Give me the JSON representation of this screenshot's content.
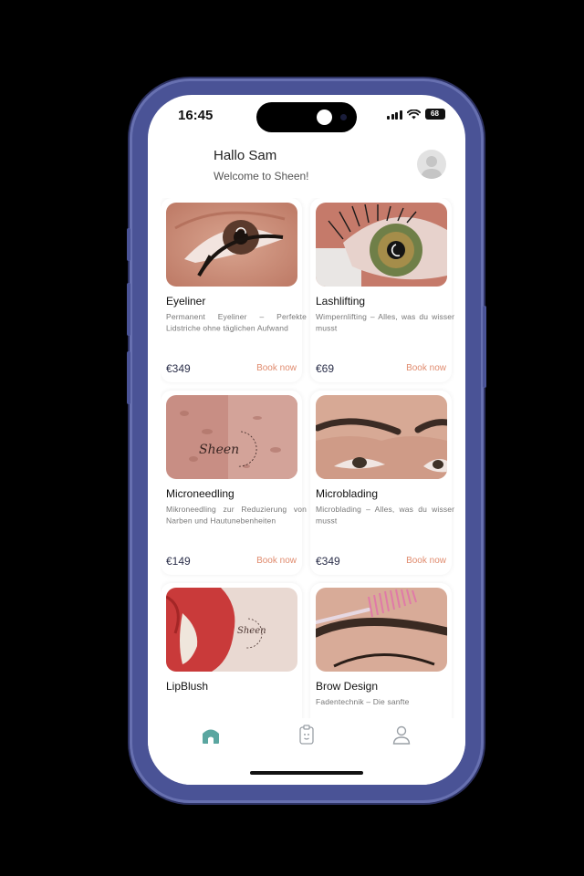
{
  "status_bar": {
    "time": "16:45",
    "battery": "68"
  },
  "header": {
    "title": "Hallo Sam",
    "subtitle": "Welcome to Sheen!"
  },
  "services": [
    {
      "title": "Eyeliner",
      "description": "Permanent Eyeliner – Perfekte Lidstriche ohne täglichen Aufwand",
      "price": "€349",
      "action": "Book now",
      "image_icon": "eyeliner-photo"
    },
    {
      "title": "Lashlifting",
      "description": "Wimpernlifting – Alles, was du wissen musst",
      "price": "€69",
      "action": "Book now",
      "image_icon": "lashlifting-photo"
    },
    {
      "title": "Microneedling",
      "description": "Mikroneedling zur Reduzierung von Narben und Hautunebenheiten",
      "price": "€149",
      "action": "Book now",
      "image_icon": "microneedling-photo"
    },
    {
      "title": "Microblading",
      "description": "Microblading – Alles, was du wissen musst",
      "price": "€349",
      "action": "Book now",
      "image_icon": "microblading-photo"
    },
    {
      "title": "LipBlush",
      "description": "",
      "price": "",
      "action": "",
      "image_icon": "lipblush-photo"
    },
    {
      "title": "Brow Design",
      "description": "Fadentechnik – Die sanfte",
      "price": "",
      "action": "",
      "image_icon": "brow-design-photo"
    }
  ],
  "watermark_text": "Sheen",
  "tab_bar": {
    "items": [
      {
        "icon": "home-icon",
        "active": true
      },
      {
        "icon": "clipboard-icon",
        "active": false
      },
      {
        "icon": "profile-icon",
        "active": false
      }
    ]
  },
  "colors": {
    "accent": "#5aa6a0",
    "price": "#2b2f4a",
    "book_now": "#e08b6e",
    "frame": "#4a5396"
  }
}
